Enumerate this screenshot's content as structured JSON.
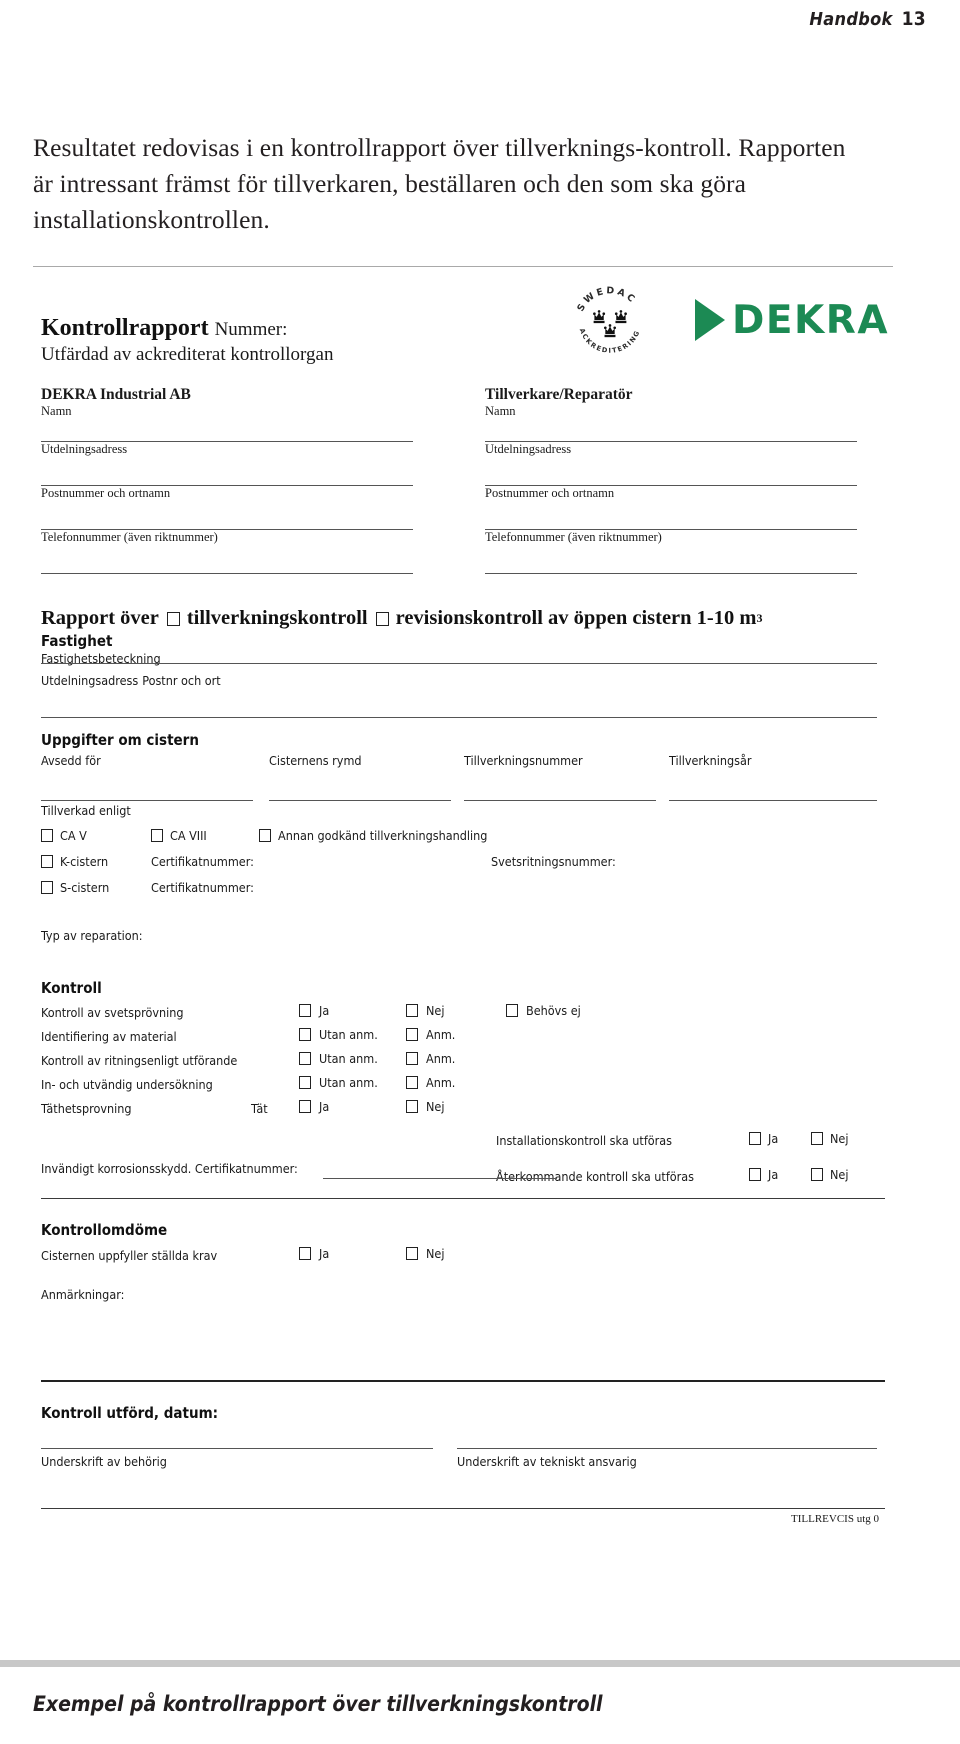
{
  "running_head": {
    "book": "Handbok",
    "page": "13"
  },
  "intro_paragraph": "Resultatet redovisas i en kontrollrapport över tillverknings-kontroll. Rapporten är intressant främst för tillverkaren, beställaren och den som ska göra installationskontrollen.",
  "form": {
    "logos": {
      "swedac": {
        "ring_top": "SWEDAC",
        "ring_bottom": "ACKREDITERING",
        "name": "swedac-accreditation-seal"
      },
      "dekra": {
        "text": "DEKRA",
        "color": "#1c8a54"
      }
    },
    "title": "Kontrollrapport",
    "title_suffix": "Nummer:",
    "subtitle": "Utfärdad av ackrediterat kontrollorgan",
    "parties": [
      {
        "name": "DEKRA Industrial AB",
        "fields": [
          {
            "label": "Namn"
          },
          {
            "label": "Utdelningsadress"
          },
          {
            "label": "Postnummer och ortnamn"
          },
          {
            "label": "Telefonnummer (även riktnummer)"
          }
        ]
      },
      {
        "name": "Tillverkare/Reparatör",
        "fields": [
          {
            "label": "Namn"
          },
          {
            "label": "Utdelningsadress"
          },
          {
            "label": "Postnummer och ortnamn"
          },
          {
            "label": "Telefonnummer (även riktnummer)"
          }
        ]
      }
    ],
    "rapport_line": {
      "prefix": "Rapport över",
      "option1": "tillverkningskontroll",
      "option2": "revisionskontroll av öppen cistern 1-10 m",
      "superscript": "3"
    },
    "fastighet": {
      "heading": "Fastighet",
      "beteckning_label": "Fastighetsbeteckning",
      "address_label": "Utdelningsadress",
      "postal_label": "Postnr och ort"
    },
    "cistern": {
      "heading": "Uppgifter om cistern",
      "columns": [
        {
          "label": "Avsedd för"
        },
        {
          "label": "Cisternens rymd"
        },
        {
          "label": "Tillverkningsnummer"
        },
        {
          "label": "Tillverkningsår"
        }
      ],
      "tillverkad_label": "Tillverkad enligt",
      "row1": [
        {
          "label": "CA V"
        },
        {
          "label": "CA VIII"
        },
        {
          "label": "Annan godkänd tillverkningshandling"
        }
      ],
      "row2": {
        "checkbox_label": "K-cistern",
        "cert_label": "Certifikatnummer:",
        "weld_label": "Svetsritningsnummer:"
      },
      "row3": {
        "checkbox_label": "S-cistern",
        "cert_label": "Certifikatnummer:"
      },
      "reparation_label": "Typ av reparation:"
    },
    "kontroll": {
      "heading": "Kontroll",
      "rows": [
        {
          "name": "Kontroll av svetsprövning",
          "mid": "",
          "options": [
            "Ja",
            "Nej",
            "Behövs ej"
          ]
        },
        {
          "name": "Identifiering av material",
          "mid": "",
          "options": [
            "Utan anm.",
            "Anm."
          ]
        },
        {
          "name": "Kontroll av ritningsenligt utförande",
          "mid": "",
          "options": [
            "Utan anm.",
            "Anm."
          ]
        },
        {
          "name": "In- och utvändig undersökning",
          "mid": "",
          "options": [
            "Utan anm.",
            "Anm."
          ]
        },
        {
          "name": "Täthetsprovning",
          "mid": "Tät",
          "options": [
            "Ja",
            "Nej"
          ]
        }
      ],
      "right_rows": [
        {
          "name": "Installationskontroll ska utföras",
          "opt1": "Ja",
          "opt2": "Nej"
        },
        {
          "name": "Återkommande kontroll ska utföras",
          "opt1": "Ja",
          "opt2": "Nej"
        }
      ],
      "korrosion_label": "Invändigt korrosionsskydd. Certifikatnummer:"
    },
    "kontrollomdome": {
      "heading": "Kontrollomdöme",
      "row_label": "Cisternen uppfyller ställda krav",
      "opt1": "Ja",
      "opt2": "Nej",
      "anmarkningar_label": "Anmärkningar:"
    },
    "signature": {
      "date_heading": "Kontroll utförd, datum:",
      "left_label": "Underskrift av behörig",
      "right_label": "Underskrift av tekniskt ansvarig"
    },
    "form_code": "TILLREVCIS utg 0"
  },
  "figure_caption": "Exempel på kontrollrapport över tillverkningskontroll"
}
